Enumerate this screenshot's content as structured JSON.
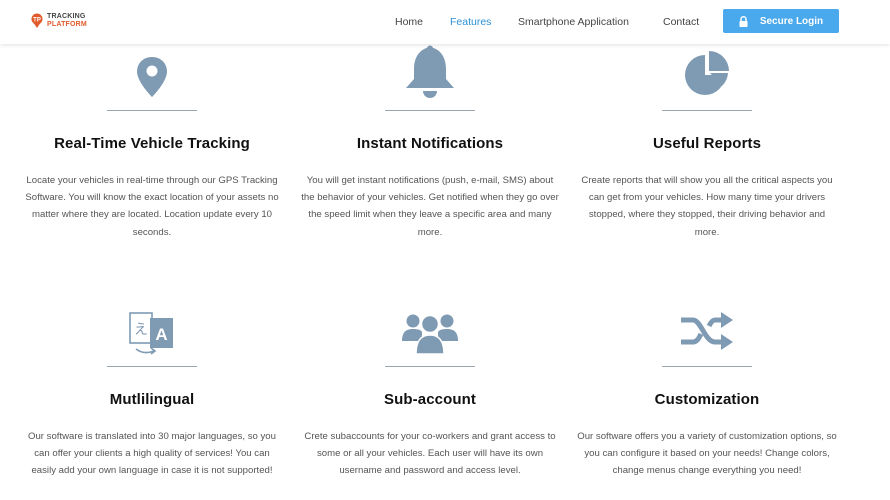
{
  "header": {
    "logo_line1": "TRACKING",
    "logo_line2": "PLATFORM",
    "nav": [
      {
        "label": "Home",
        "active": false
      },
      {
        "label": "Features",
        "active": true
      },
      {
        "label": "Smartphone Application",
        "active": false
      },
      {
        "label": "Contact",
        "active": false
      }
    ],
    "login_label": "Secure Login"
  },
  "colors": {
    "accent": "#4aa8ec",
    "active_nav": "#2c8fd6",
    "icon": "#7f9ab3",
    "brand": "#e05a2b"
  },
  "features": [
    {
      "icon": "map-pin-icon",
      "title": "Real-Time Vehicle Tracking",
      "text": "Locate your vehicles in real-time through our GPS Tracking Software. You will know the exact location of your assets no matter where they are located. Location update every 10 seconds."
    },
    {
      "icon": "bell-icon",
      "title": "Instant Notifications",
      "text": "You will get instant notifications (push, e-mail, SMS) about the behavior of your vehicles. Get notified when they go over the speed limit when they leave a specific area and many more."
    },
    {
      "icon": "pie-chart-icon",
      "title": "Useful Reports",
      "text": "Create reports that will show you all the critical aspects you can get from your vehicles. How many time your drivers stopped, where they stopped, their driving behavior and more."
    },
    {
      "icon": "translate-icon",
      "title": "Mutlilingual",
      "text": "Our software is translated into 30 major languages, so you can offer your clients a high quality of services! You can easily add your own language in case it is not supported!"
    },
    {
      "icon": "users-icon",
      "title": "Sub-account",
      "text": "Crete subaccounts for your co-workers and grant access to some or all your vehicles. Each user will have its own username and password and access level."
    },
    {
      "icon": "shuffle-icon",
      "title": "Customization",
      "text": "Our software offers you a variety of customization options, so you can configure it based on your needs! Change colors, change menus change everything you need!"
    }
  ]
}
